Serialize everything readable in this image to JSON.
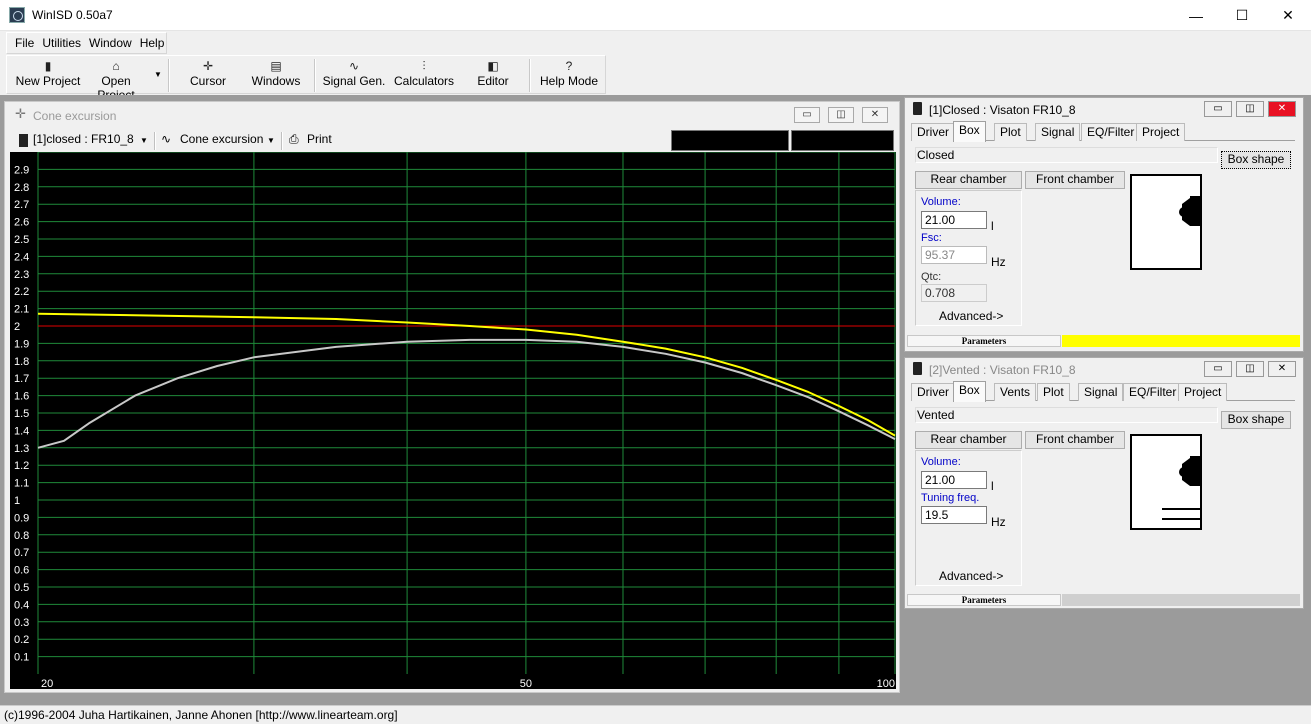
{
  "window": {
    "title": "WinISD 0.50a7",
    "minimize": "—",
    "maximize": "☐",
    "close": "✕"
  },
  "menu": [
    "File",
    "Utilities",
    "Window",
    "Help"
  ],
  "toolbar": [
    {
      "label": "New Project",
      "icon": "new-project-icon",
      "glyph": "▮"
    },
    {
      "label": "Open Project",
      "icon": "open-folder-icon",
      "glyph": "⌂"
    },
    {
      "label": "Cursor",
      "icon": "cursor-icon",
      "glyph": "✛"
    },
    {
      "label": "Windows",
      "icon": "windows-icon",
      "glyph": "▤"
    },
    {
      "label": "Signal Gen.",
      "icon": "sine-wave-icon",
      "glyph": "∿"
    },
    {
      "label": "Calculators",
      "icon": "calculator-icon",
      "glyph": "⫶"
    },
    {
      "label": "Editor",
      "icon": "speaker-icon",
      "glyph": "◧"
    },
    {
      "label": "Help Mode",
      "icon": "help-icon",
      "glyph": "?"
    }
  ],
  "chart_window": {
    "title": "Cone excursion",
    "project_select": "[1]closed : FR10_8",
    "graph_select": "Cone excursion",
    "print": "Print"
  },
  "chart_data": {
    "type": "line",
    "xscale": "log",
    "xlim": [
      20,
      100
    ],
    "ylim": [
      0,
      3.0
    ],
    "x_tick_labels": [
      "20",
      "50",
      "100"
    ],
    "y_ticks": [
      0.1,
      0.2,
      0.3,
      0.4,
      0.5,
      0.6,
      0.7,
      0.8,
      0.9,
      1,
      1.1,
      1.2,
      1.3,
      1.4,
      1.5,
      1.6,
      1.7,
      1.8,
      1.9,
      2,
      2.1,
      2.2,
      2.3,
      2.4,
      2.5,
      2.6,
      2.7,
      2.8,
      2.9
    ],
    "grid": true,
    "reference_line": {
      "y": 2.0,
      "color": "#e00000"
    },
    "series": [
      {
        "color": "#ffff00",
        "x": [
          20,
          25,
          30,
          35,
          40,
          45,
          50,
          55,
          60,
          65,
          70,
          75,
          80,
          85,
          90,
          95,
          100
        ],
        "y": [
          2.07,
          2.06,
          2.05,
          2.04,
          2.02,
          2.0,
          1.98,
          1.95,
          1.91,
          1.87,
          1.82,
          1.76,
          1.69,
          1.62,
          1.54,
          1.46,
          1.37
        ]
      },
      {
        "color": "#c8c8c8",
        "x": [
          20,
          21,
          22,
          24,
          26,
          28,
          30,
          35,
          40,
          45,
          50,
          55,
          60,
          65,
          70,
          75,
          80,
          85,
          90,
          95,
          100
        ],
        "y": [
          1.3,
          1.34,
          1.44,
          1.6,
          1.7,
          1.77,
          1.82,
          1.88,
          1.91,
          1.92,
          1.92,
          1.91,
          1.88,
          1.84,
          1.79,
          1.73,
          1.66,
          1.59,
          1.51,
          1.43,
          1.35
        ]
      }
    ]
  },
  "panel1": {
    "title": "[1]Closed : Visaton FR10_8",
    "tabs": [
      "Driver",
      "Box",
      "Plot",
      "Signal",
      "EQ/Filter",
      "Project"
    ],
    "box_type": "Closed",
    "box_shape": "Box shape",
    "rear": "Rear chamber",
    "front": "Front chamber",
    "volume_label": "Volume:",
    "volume": "21.00",
    "volume_unit": "l",
    "fsc_label": "Fsc:",
    "fsc": "95.37",
    "fsc_unit": "Hz",
    "qtc_label": "Qtc:",
    "qtc": "0.708",
    "advanced": "Advanced->",
    "status": "Parameters",
    "status_color": "#ffff00"
  },
  "panel2": {
    "title": "[2]Vented : Visaton FR10_8",
    "tabs": [
      "Driver",
      "Box",
      "Vents",
      "Plot",
      "Signal",
      "EQ/Filter",
      "Project"
    ],
    "box_type": "Vented",
    "box_shape": "Box shape",
    "rear": "Rear chamber",
    "front": "Front chamber",
    "volume_label": "Volume:",
    "volume": "21.00",
    "volume_unit": "l",
    "tuning_label": "Tuning freq.",
    "tuning": "19.5",
    "tuning_unit": "Hz",
    "advanced": "Advanced->",
    "status": "Parameters"
  },
  "statusbar": "(c)1996-2004 Juha Hartikainen, Janne Ahonen [http://www.linearteam.org]"
}
